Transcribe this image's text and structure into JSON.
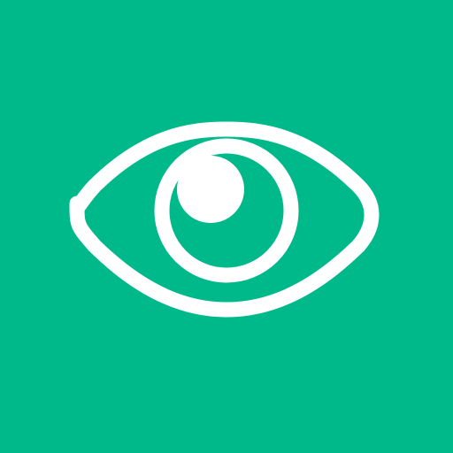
{
  "icon": {
    "name": "eye-icon",
    "background_color": "#00b98a",
    "foreground_color": "#ffffff"
  }
}
